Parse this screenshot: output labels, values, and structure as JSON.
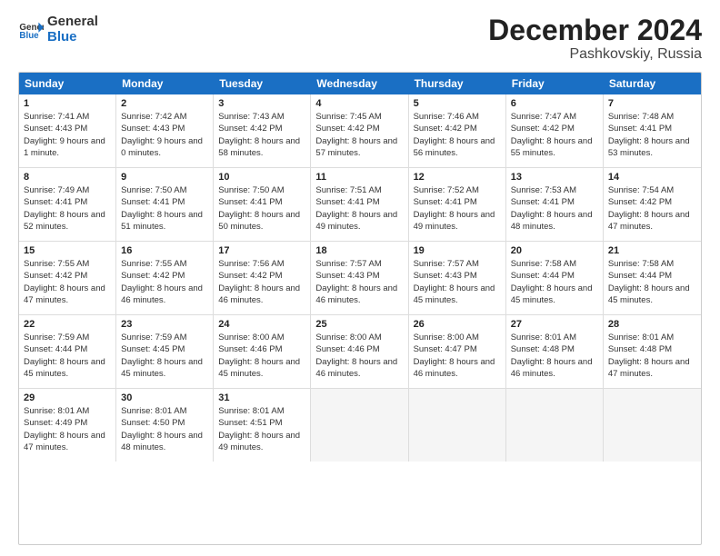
{
  "header": {
    "logo_general": "General",
    "logo_blue": "Blue",
    "main_title": "December 2024",
    "subtitle": "Pashkovskiy, Russia"
  },
  "calendar": {
    "days_of_week": [
      "Sunday",
      "Monday",
      "Tuesday",
      "Wednesday",
      "Thursday",
      "Friday",
      "Saturday"
    ],
    "weeks": [
      [
        {
          "day": "",
          "empty": true,
          "sunrise": "",
          "sunset": "",
          "daylight": ""
        },
        {
          "day": "2",
          "empty": false,
          "sunrise": "Sunrise: 7:42 AM",
          "sunset": "Sunset: 4:43 PM",
          "daylight": "Daylight: 9 hours and 0 minutes."
        },
        {
          "day": "3",
          "empty": false,
          "sunrise": "Sunrise: 7:43 AM",
          "sunset": "Sunset: 4:42 PM",
          "daylight": "Daylight: 8 hours and 58 minutes."
        },
        {
          "day": "4",
          "empty": false,
          "sunrise": "Sunrise: 7:45 AM",
          "sunset": "Sunset: 4:42 PM",
          "daylight": "Daylight: 8 hours and 57 minutes."
        },
        {
          "day": "5",
          "empty": false,
          "sunrise": "Sunrise: 7:46 AM",
          "sunset": "Sunset: 4:42 PM",
          "daylight": "Daylight: 8 hours and 56 minutes."
        },
        {
          "day": "6",
          "empty": false,
          "sunrise": "Sunrise: 7:47 AM",
          "sunset": "Sunset: 4:42 PM",
          "daylight": "Daylight: 8 hours and 55 minutes."
        },
        {
          "day": "7",
          "empty": false,
          "sunrise": "Sunrise: 7:48 AM",
          "sunset": "Sunset: 4:41 PM",
          "daylight": "Daylight: 8 hours and 53 minutes."
        }
      ],
      [
        {
          "day": "8",
          "empty": false,
          "sunrise": "Sunrise: 7:49 AM",
          "sunset": "Sunset: 4:41 PM",
          "daylight": "Daylight: 8 hours and 52 minutes."
        },
        {
          "day": "9",
          "empty": false,
          "sunrise": "Sunrise: 7:50 AM",
          "sunset": "Sunset: 4:41 PM",
          "daylight": "Daylight: 8 hours and 51 minutes."
        },
        {
          "day": "10",
          "empty": false,
          "sunrise": "Sunrise: 7:50 AM",
          "sunset": "Sunset: 4:41 PM",
          "daylight": "Daylight: 8 hours and 50 minutes."
        },
        {
          "day": "11",
          "empty": false,
          "sunrise": "Sunrise: 7:51 AM",
          "sunset": "Sunset: 4:41 PM",
          "daylight": "Daylight: 8 hours and 49 minutes."
        },
        {
          "day": "12",
          "empty": false,
          "sunrise": "Sunrise: 7:52 AM",
          "sunset": "Sunset: 4:41 PM",
          "daylight": "Daylight: 8 hours and 49 minutes."
        },
        {
          "day": "13",
          "empty": false,
          "sunrise": "Sunrise: 7:53 AM",
          "sunset": "Sunset: 4:41 PM",
          "daylight": "Daylight: 8 hours and 48 minutes."
        },
        {
          "day": "14",
          "empty": false,
          "sunrise": "Sunrise: 7:54 AM",
          "sunset": "Sunset: 4:42 PM",
          "daylight": "Daylight: 8 hours and 47 minutes."
        }
      ],
      [
        {
          "day": "15",
          "empty": false,
          "sunrise": "Sunrise: 7:55 AM",
          "sunset": "Sunset: 4:42 PM",
          "daylight": "Daylight: 8 hours and 47 minutes."
        },
        {
          "day": "16",
          "empty": false,
          "sunrise": "Sunrise: 7:55 AM",
          "sunset": "Sunset: 4:42 PM",
          "daylight": "Daylight: 8 hours and 46 minutes."
        },
        {
          "day": "17",
          "empty": false,
          "sunrise": "Sunrise: 7:56 AM",
          "sunset": "Sunset: 4:42 PM",
          "daylight": "Daylight: 8 hours and 46 minutes."
        },
        {
          "day": "18",
          "empty": false,
          "sunrise": "Sunrise: 7:57 AM",
          "sunset": "Sunset: 4:43 PM",
          "daylight": "Daylight: 8 hours and 46 minutes."
        },
        {
          "day": "19",
          "empty": false,
          "sunrise": "Sunrise: 7:57 AM",
          "sunset": "Sunset: 4:43 PM",
          "daylight": "Daylight: 8 hours and 45 minutes."
        },
        {
          "day": "20",
          "empty": false,
          "sunrise": "Sunrise: 7:58 AM",
          "sunset": "Sunset: 4:44 PM",
          "daylight": "Daylight: 8 hours and 45 minutes."
        },
        {
          "day": "21",
          "empty": false,
          "sunrise": "Sunrise: 7:58 AM",
          "sunset": "Sunset: 4:44 PM",
          "daylight": "Daylight: 8 hours and 45 minutes."
        }
      ],
      [
        {
          "day": "22",
          "empty": false,
          "sunrise": "Sunrise: 7:59 AM",
          "sunset": "Sunset: 4:44 PM",
          "daylight": "Daylight: 8 hours and 45 minutes."
        },
        {
          "day": "23",
          "empty": false,
          "sunrise": "Sunrise: 7:59 AM",
          "sunset": "Sunset: 4:45 PM",
          "daylight": "Daylight: 8 hours and 45 minutes."
        },
        {
          "day": "24",
          "empty": false,
          "sunrise": "Sunrise: 8:00 AM",
          "sunset": "Sunset: 4:46 PM",
          "daylight": "Daylight: 8 hours and 45 minutes."
        },
        {
          "day": "25",
          "empty": false,
          "sunrise": "Sunrise: 8:00 AM",
          "sunset": "Sunset: 4:46 PM",
          "daylight": "Daylight: 8 hours and 46 minutes."
        },
        {
          "day": "26",
          "empty": false,
          "sunrise": "Sunrise: 8:00 AM",
          "sunset": "Sunset: 4:47 PM",
          "daylight": "Daylight: 8 hours and 46 minutes."
        },
        {
          "day": "27",
          "empty": false,
          "sunrise": "Sunrise: 8:01 AM",
          "sunset": "Sunset: 4:48 PM",
          "daylight": "Daylight: 8 hours and 46 minutes."
        },
        {
          "day": "28",
          "empty": false,
          "sunrise": "Sunrise: 8:01 AM",
          "sunset": "Sunset: 4:48 PM",
          "daylight": "Daylight: 8 hours and 47 minutes."
        }
      ],
      [
        {
          "day": "29",
          "empty": false,
          "sunrise": "Sunrise: 8:01 AM",
          "sunset": "Sunset: 4:49 PM",
          "daylight": "Daylight: 8 hours and 47 minutes."
        },
        {
          "day": "30",
          "empty": false,
          "sunrise": "Sunrise: 8:01 AM",
          "sunset": "Sunset: 4:50 PM",
          "daylight": "Daylight: 8 hours and 48 minutes."
        },
        {
          "day": "31",
          "empty": false,
          "sunrise": "Sunrise: 8:01 AM",
          "sunset": "Sunset: 4:51 PM",
          "daylight": "Daylight: 8 hours and 49 minutes."
        },
        {
          "day": "",
          "empty": true,
          "sunrise": "",
          "sunset": "",
          "daylight": ""
        },
        {
          "day": "",
          "empty": true,
          "sunrise": "",
          "sunset": "",
          "daylight": ""
        },
        {
          "day": "",
          "empty": true,
          "sunrise": "",
          "sunset": "",
          "daylight": ""
        },
        {
          "day": "",
          "empty": true,
          "sunrise": "",
          "sunset": "",
          "daylight": ""
        }
      ]
    ],
    "week0_day1": {
      "day": "1",
      "sunrise": "Sunrise: 7:41 AM",
      "sunset": "Sunset: 4:43 PM",
      "daylight": "Daylight: 9 hours and 1 minute."
    }
  }
}
